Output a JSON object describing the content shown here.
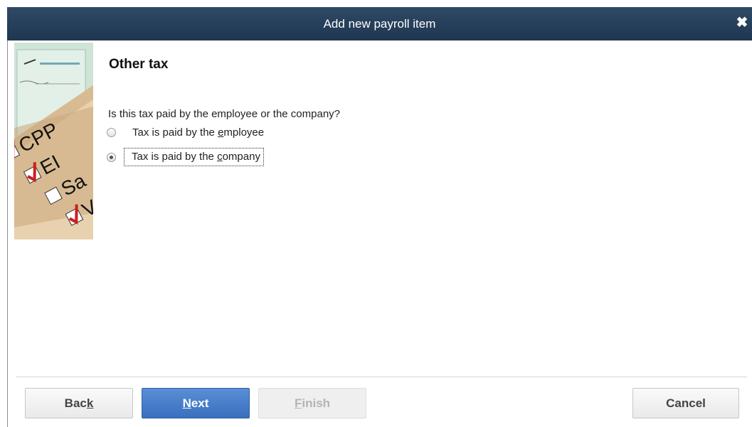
{
  "window": {
    "title": "Add new payroll item"
  },
  "illustration": {
    "labels": [
      "CPP",
      "EI",
      "Sa",
      "V"
    ]
  },
  "page": {
    "heading": "Other tax",
    "question": "Is this tax paid by the employee or the company?",
    "options": [
      {
        "pre": "Tax is paid by the ",
        "accel": "e",
        "post": "mployee",
        "selected": false
      },
      {
        "pre": "Tax is paid by the ",
        "accel": "c",
        "post": "ompany",
        "selected": true
      }
    ]
  },
  "buttons": {
    "back": {
      "pre": "Bac",
      "accel": "k",
      "post": ""
    },
    "next": {
      "pre": "",
      "accel": "N",
      "post": "ext"
    },
    "finish": {
      "pre": "",
      "accel": "F",
      "post": "inish"
    },
    "cancel": "Cancel"
  },
  "colors": {
    "titlebar": "#2e4a66",
    "primary_button": "#3a6fbf",
    "check_red": "#cc1f1f"
  }
}
